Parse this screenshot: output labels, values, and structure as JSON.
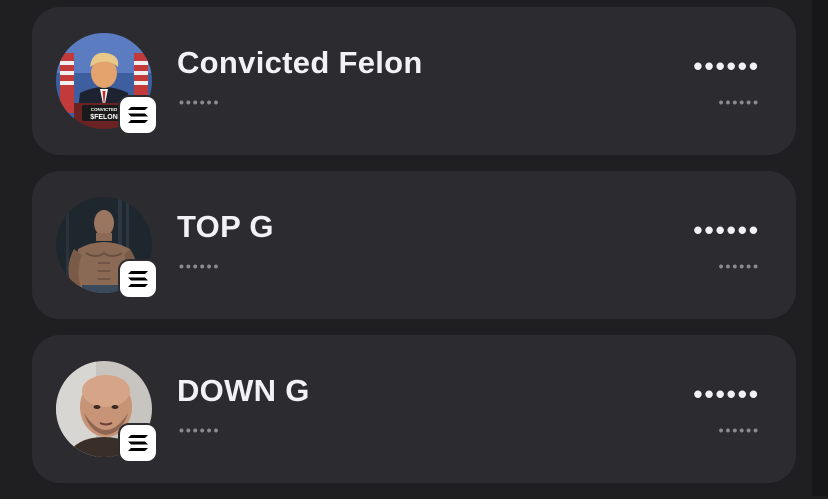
{
  "tokens": [
    {
      "name": "Convicted Felon",
      "subtitle_masked": "••••••",
      "value_masked": "••••••",
      "change_masked": "••••••",
      "avatar": "trump-podium-avatar",
      "avatar_text": "CONVICTED $FELON",
      "chain_icon": "solana-icon"
    },
    {
      "name": "TOP G",
      "subtitle_masked": "••••••",
      "value_masked": "••••••",
      "change_masked": "••••••",
      "avatar": "muscular-man-avatar",
      "chain_icon": "solana-icon"
    },
    {
      "name": "DOWN G",
      "subtitle_masked": "••••••",
      "value_masked": "••••••",
      "change_masked": "••••••",
      "avatar": "bald-man-avatar",
      "chain_icon": "solana-icon"
    }
  ],
  "colors": {
    "background": "#1f1f22",
    "card": "#2c2c30",
    "text_primary": "#f2f2f4",
    "text_secondary": "#8a8a90"
  }
}
